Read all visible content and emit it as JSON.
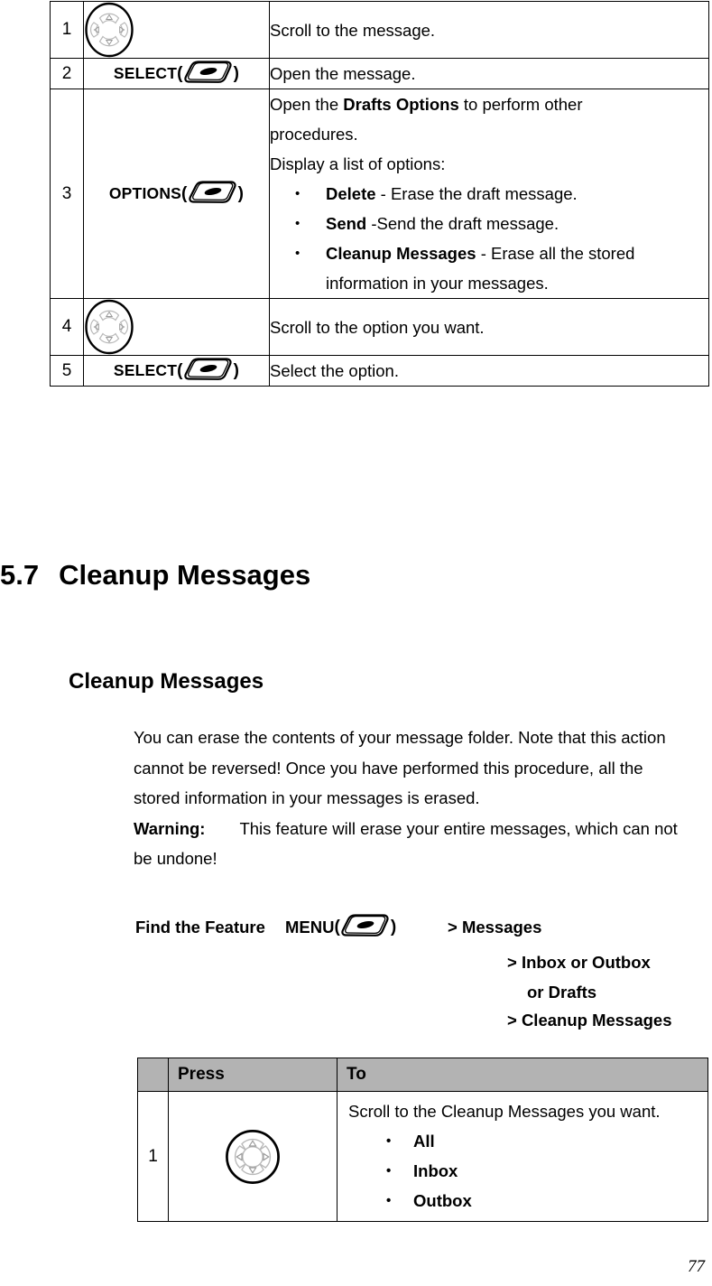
{
  "page": {
    "number": "77"
  },
  "top_table": {
    "rows": [
      {
        "num": "1",
        "press_icon": "navigation-key-icon",
        "press_label": "",
        "to_lines": [
          "Scroll to the message."
        ]
      },
      {
        "num": "2",
        "press_icon": "softkey-icon",
        "press_label": "SELECT",
        "to_lines": [
          "Open the message."
        ]
      },
      {
        "num": "3",
        "press_icon": "softkey-icon",
        "press_label": "OPTIONS",
        "intro_line1_a": "Open the ",
        "intro_line1_b": "Drafts Options",
        "intro_line1_c": " to perform other",
        "intro_line2": "procedures.",
        "intro_line3": "Display a list of options:",
        "options": [
          {
            "term": "Delete",
            "desc": " - Erase the draft message."
          },
          {
            "term": "Send",
            "desc": " -Send the draft message."
          },
          {
            "term": "Cleanup Messages",
            "desc": " - Erase all the stored information in your messages."
          }
        ]
      },
      {
        "num": "4",
        "press_icon": "navigation-key-icon",
        "press_label": "",
        "to_lines": [
          "Scroll to the option you want."
        ]
      },
      {
        "num": "5",
        "press_icon": "softkey-icon",
        "press_label": "SELECT",
        "to_lines": [
          "Select the option."
        ]
      }
    ],
    "paren_open": "(",
    "paren_close": ")"
  },
  "section": {
    "number": "5.7",
    "title": "Cleanup Messages",
    "subtitle": "Cleanup Messages"
  },
  "body": {
    "paragraph": "You can erase the contents of your message folder. Note that this action cannot be reversed! Once you have performed this procedure, all the stored information in your messages is erased.",
    "warning_label": "Warning:",
    "warning_text": "This feature will erase your entire messages, which can not be undone!"
  },
  "find_feature": {
    "label": "Find the Feature",
    "menu_label": "MENU",
    "paren_open": "(",
    "paren_close": ")",
    "path_1": "> Messages",
    "path_2": "> Inbox or Outbox",
    "path_3": "or Drafts",
    "path_4": ">  Cleanup Messages"
  },
  "bottom_table": {
    "headers": {
      "num": "",
      "press": "Press",
      "to": "To"
    },
    "rows": [
      {
        "num": "1",
        "press_icon": "navigation-key-icon",
        "to_intro": "Scroll to the Cleanup Messages you want.",
        "options": [
          "All",
          "Inbox",
          "Outbox"
        ]
      }
    ]
  },
  "colors": {
    "header_fill": "#b3b3b3",
    "border": "#000000",
    "text": "#000000"
  }
}
